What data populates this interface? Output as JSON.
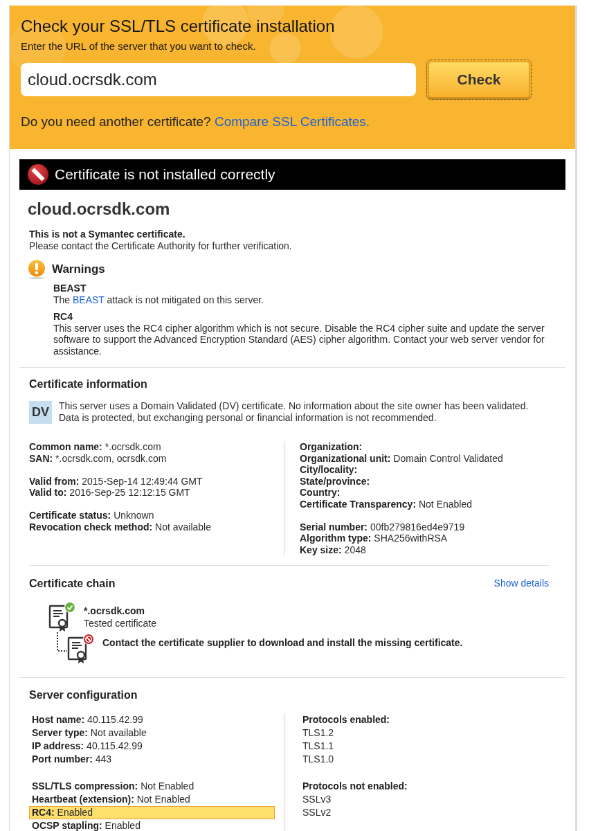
{
  "header": {
    "title": "Check your SSL/TLS certificate installation",
    "subtitle": "Enter the URL of the server that you want to check.",
    "url_field": {
      "value": "cloud.ocrsdk.com"
    },
    "check_button": {
      "label": "Check",
      "focused": true
    },
    "prompt": "Do you need another certificate?",
    "prompt_link": "Compare SSL Certificates."
  },
  "status_banner": {
    "kind": "error",
    "text": "Certificate is not installed correctly"
  },
  "result": {
    "hostname": "cloud.ocrsdk.com",
    "notice_title": "This is not a Symantec certificate.",
    "notice_text": "Please contact the Certificate Authority for further verification."
  },
  "warnings": {
    "title": "Warnings",
    "items": [
      {
        "name": "BEAST",
        "parts": [
          {
            "kind": "text",
            "text": "The "
          },
          {
            "kind": "link",
            "text": "BEAST"
          },
          {
            "kind": "text",
            "text": " attack is not mitigated on this server."
          }
        ]
      },
      {
        "name": "RC4",
        "parts": [
          {
            "kind": "text",
            "text": "This server uses the RC4 cipher algorithm which is not secure. Disable the RC4 cipher suite and update the server software to support the Advanced Encryption Standard (AES) cipher algorithm. Contact your web server vendor for assistance."
          }
        ]
      }
    ]
  },
  "certificate_information": {
    "title": "Certificate information",
    "validation_badge": "DV",
    "validation_text": "This server uses a Domain Validated (DV) certificate. No information about the site owner has been validated. Data is protected, but exchanging personal or financial information is not recommended.",
    "columns": [
      {
        "groups": [
          [
            {
              "label": "Common name:",
              "value": "*.ocrsdk.com"
            },
            {
              "label": "SAN:",
              "value": "*.ocrsdk.com, ocrsdk.com"
            }
          ],
          [
            {
              "label": "Valid from:",
              "value": "2015-Sep-14 12:49:44 GMT"
            },
            {
              "label": "Valid to:",
              "value": "2016-Sep-25 12:12:15 GMT"
            }
          ],
          [
            {
              "label": "Certificate status:",
              "value": "Unknown"
            },
            {
              "label": "Revocation check method:",
              "value": "Not available"
            }
          ]
        ]
      },
      {
        "groups": [
          [
            {
              "label": "Organization:"
            },
            {
              "label": "Organizational unit:",
              "value": "Domain Control Validated"
            },
            {
              "label": "City/locality:"
            },
            {
              "label": "State/province:"
            },
            {
              "label": "Country:"
            },
            {
              "label": "Certificate Transparency:",
              "value": "Not Enabled"
            }
          ],
          [
            {
              "label": "Serial number:",
              "value": "00fb279816ed4e9719"
            },
            {
              "label": "Algorithm type:",
              "value": "SHA256withRSA"
            },
            {
              "label": "Key size:",
              "value": "2048"
            }
          ]
        ]
      }
    ]
  },
  "certificate_chain": {
    "title": "Certificate chain",
    "details_link": "Show details",
    "certificates": [
      {
        "kind": "valid",
        "name": "*.ocrsdk.com",
        "note": "Tested certificate"
      },
      {
        "kind": "missing",
        "message": "Contact the certificate supplier to download and install the missing certificate."
      }
    ]
  },
  "server_configuration": {
    "title": "Server configuration",
    "settings": [
      [
        {
          "label": "Host name:",
          "value": "40.115.42.99",
          "highlighted": false
        },
        {
          "label": "Server type:",
          "value": "Not available",
          "highlighted": false
        },
        {
          "label": "IP address:",
          "value": "40.115.42.99",
          "highlighted": false
        },
        {
          "label": "Port number:",
          "value": "443",
          "highlighted": false
        }
      ],
      [
        {
          "label": "SSL/TLS compression:",
          "value": "Not Enabled",
          "highlighted": false
        },
        {
          "label": "Heartbeat (extension):",
          "value": "Not Enabled",
          "highlighted": false
        },
        {
          "label": "RC4:",
          "value": "Enabled",
          "highlighted": true
        },
        {
          "label": "OCSP stapling:",
          "value": "Enabled",
          "highlighted": false
        }
      ]
    ],
    "protocols": [
      {
        "heading": "Protocols enabled:",
        "items": [
          "TLS1.2",
          "TLS1.1",
          "TLS1.0"
        ]
      },
      {
        "heading": "Protocols not enabled:",
        "items": [
          "SSLv3",
          "SSLv2"
        ]
      }
    ]
  }
}
